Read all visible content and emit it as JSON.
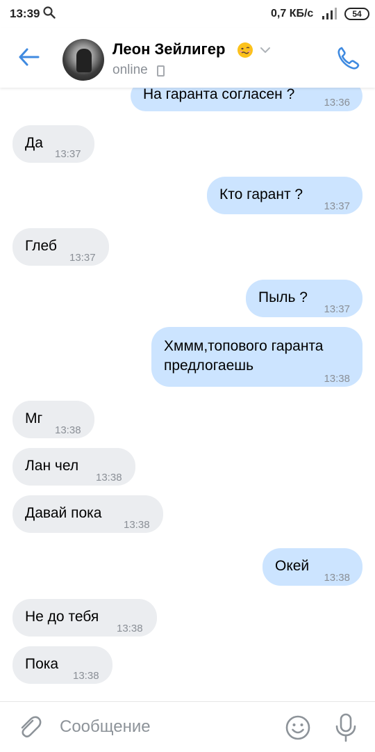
{
  "status_bar": {
    "time": "13:39",
    "net_speed": "0,7 КБ/с",
    "battery": "54"
  },
  "header": {
    "name": "Леон Зейлигер",
    "status": "online"
  },
  "messages": [
    {
      "dir": "out",
      "text": "На гаранта согласен ?",
      "time": "13:36"
    },
    {
      "dir": "in",
      "text": "Да",
      "time": "13:37"
    },
    {
      "dir": "out",
      "text": "Кто гарант ?",
      "time": "13:37"
    },
    {
      "dir": "in",
      "text": "Глеб",
      "time": "13:37"
    },
    {
      "dir": "out",
      "text": "Пыль ?",
      "time": "13:37"
    },
    {
      "dir": "out",
      "text_line1": "Хммм,топового гаранта",
      "text_line2": "предлогаешь",
      "time": "13:38"
    },
    {
      "dir": "in",
      "text": "Мг",
      "time": "13:38"
    },
    {
      "dir": "in",
      "text": "Лан чел",
      "time": "13:38"
    },
    {
      "dir": "in",
      "text": "Давай пока",
      "time": "13:38"
    },
    {
      "dir": "out",
      "text": "Окей",
      "time": "13:38"
    },
    {
      "dir": "in",
      "text": "Не до тебя",
      "time": "13:38"
    },
    {
      "dir": "in",
      "text": "Пока",
      "time": "13:38"
    }
  ],
  "composer": {
    "placeholder": "Сообщение"
  },
  "colors": {
    "accent": "#3f8ae0",
    "incoming_bubble": "#ebedf0",
    "outgoing_bubble": "#cce4ff"
  }
}
